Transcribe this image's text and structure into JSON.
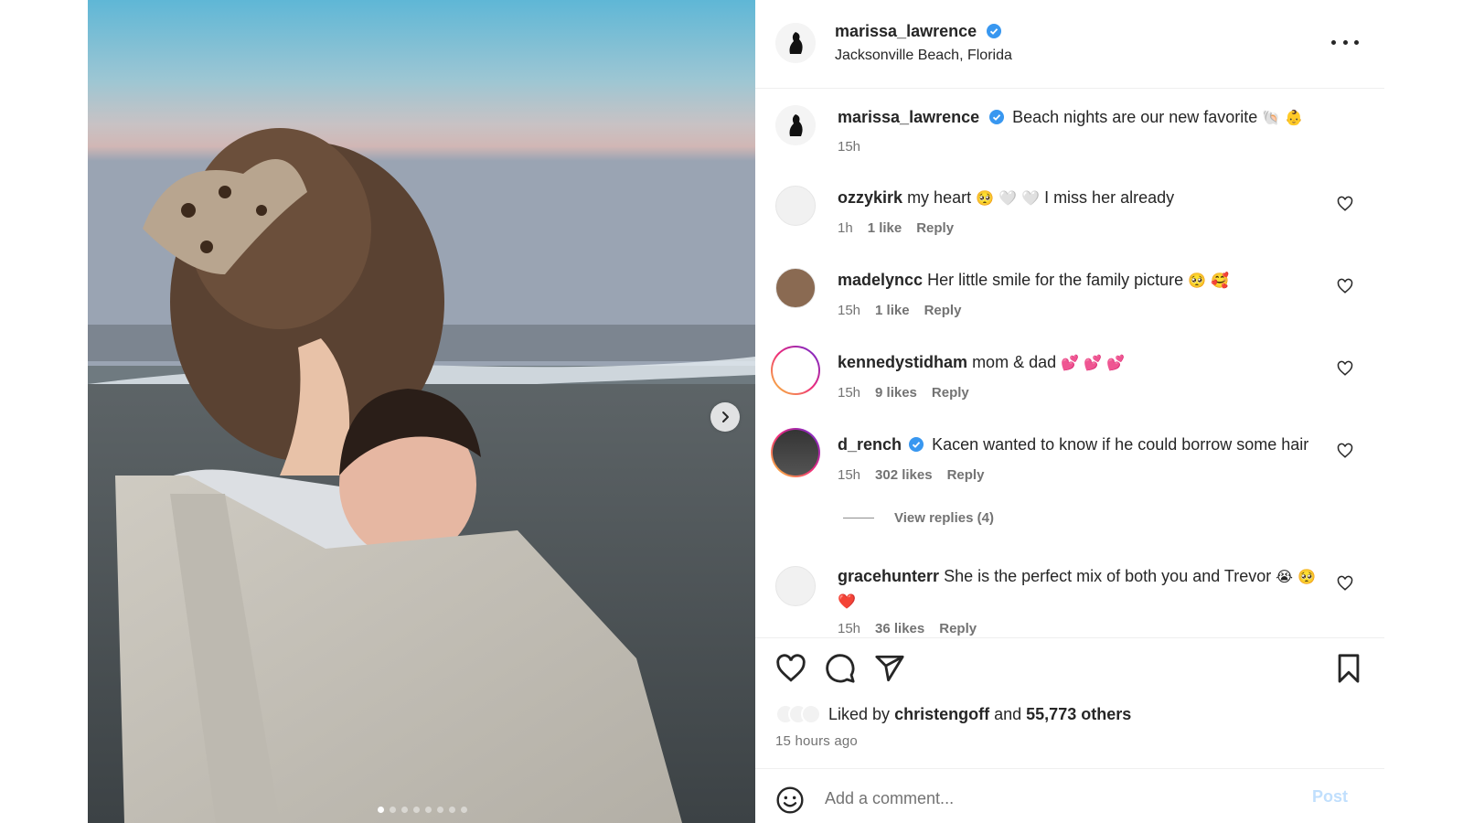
{
  "post": {
    "author": "marissa_lawrence",
    "location": "Jacksonville Beach, Florida",
    "caption": "Beach nights are our new favorite",
    "caption_emoji": "🐚 👶",
    "caption_time": "15h",
    "carousel": {
      "slide_count": 8,
      "active_index": 0
    }
  },
  "comments": [
    {
      "user": "ozzykirk",
      "text": "my heart",
      "emoji": "🥺 🤍 🤍",
      "text2": "I miss her already",
      "time": "1h",
      "likes": "1 like",
      "reply": "Reply"
    },
    {
      "user": "madelyncc",
      "text": "Her little smile for the family picture",
      "emoji": "🥺 🥰",
      "time": "15h",
      "likes": "1 like",
      "reply": "Reply"
    },
    {
      "user": "kennedystidham",
      "text": "mom & dad",
      "emoji": "💕 💕 💕",
      "time": "15h",
      "likes": "9 likes",
      "reply": "Reply"
    },
    {
      "user": "d_rench",
      "text": "Kacen wanted to know if he could borrow some hair",
      "time": "15h",
      "likes": "302 likes",
      "reply": "Reply",
      "view_replies": "View replies (4)"
    },
    {
      "user": "gracehunterr",
      "text": "She is the perfect mix of both you and Trevor",
      "emoji": "😭",
      "emoji2": "🥺 ❤️",
      "time": "15h",
      "likes": "36 likes",
      "reply": "Reply"
    }
  ],
  "likes": {
    "prefix": "Liked by",
    "user": "christengoff",
    "middle": "and",
    "others": "55,773 others"
  },
  "time_ago": "15 hours ago",
  "add_comment": {
    "placeholder": "Add a comment...",
    "post_label": "Post"
  },
  "colors": {
    "verified": "#3897f0",
    "muted": "#737373",
    "post_disabled": "#c0dffd"
  },
  "icons": [
    "more-icon",
    "heart-icon",
    "comment-icon",
    "share-icon",
    "bookmark-icon",
    "smile-icon",
    "chevron-right-icon",
    "verified-icon"
  ]
}
